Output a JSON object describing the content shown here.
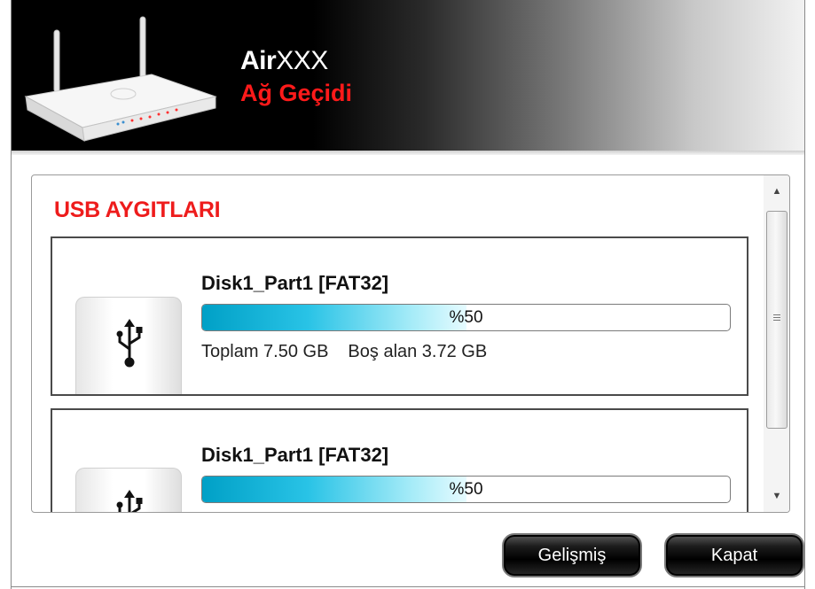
{
  "header": {
    "product_name_bold": "Air",
    "product_name_light": "XXX",
    "product_subtitle": "Ağ Geçidi",
    "router_icon": "router-image"
  },
  "panel": {
    "title": "USB AYGITLARI"
  },
  "disks": [
    {
      "name": "Disk1_Part1 [FAT32]",
      "usage_percent": 50,
      "usage_label": "%50",
      "total_label": "Toplam 7.50 GB",
      "free_label": "Boş alan 3.72 GB",
      "icon": "usb-icon"
    },
    {
      "name": "Disk1_Part1 [FAT32]",
      "usage_percent": 50,
      "usage_label": "%50",
      "icon": "usb-icon"
    }
  ],
  "scrollbar": {
    "up_icon": "arrow-up-icon",
    "down_icon": "arrow-down-icon"
  },
  "buttons": {
    "advanced_label": "Gelişmiş",
    "close_label": "Kapat"
  },
  "colors": {
    "accent_red": "#ee1c1c",
    "progress_start": "#00a0c6",
    "progress_end": "#e6fbff"
  }
}
